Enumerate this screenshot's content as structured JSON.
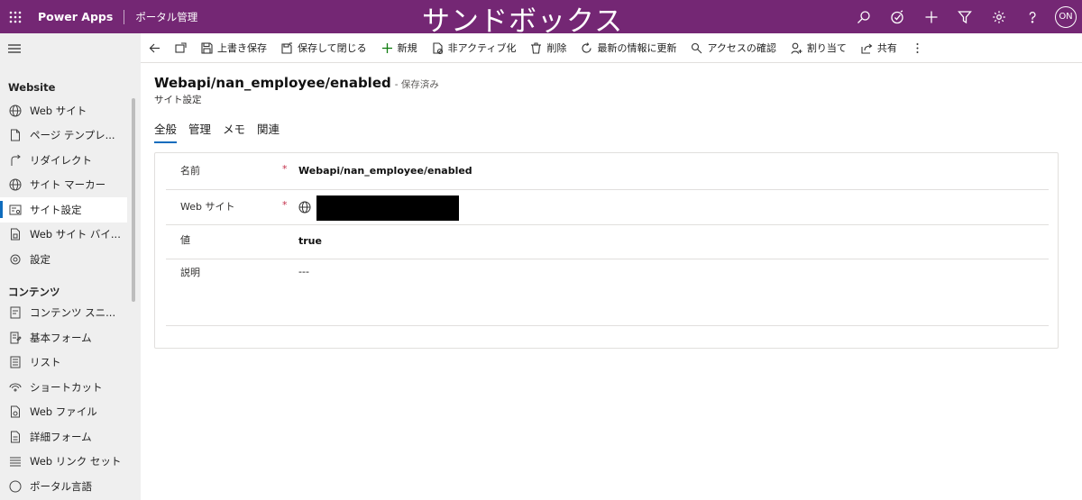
{
  "app": {
    "name": "Power Apps",
    "area": "ポータル管理",
    "banner": "サンドボックス",
    "user_initials": "ON"
  },
  "sidebar": {
    "groups": [
      {
        "label": "Website",
        "items": [
          {
            "label": "Web サイト",
            "icon": "globe-icon"
          },
          {
            "label": "ページ テンプレ...",
            "icon": "page-icon"
          },
          {
            "label": "リダイレクト",
            "icon": "redirect-icon"
          },
          {
            "label": "サイト マーカー",
            "icon": "globe-icon"
          },
          {
            "label": "サイト設定",
            "icon": "settings-list-icon",
            "active": true
          },
          {
            "label": "Web サイト バイ...",
            "icon": "binding-icon"
          },
          {
            "label": "設定",
            "icon": "gear-icon"
          }
        ]
      },
      {
        "label": "コンテンツ",
        "items": [
          {
            "label": "コンテンツ スニ...",
            "icon": "snippet-icon"
          },
          {
            "label": "基本フォーム",
            "icon": "form-icon"
          },
          {
            "label": "リスト",
            "icon": "list-icon"
          },
          {
            "label": "ショートカット",
            "icon": "shortcut-icon"
          },
          {
            "label": "Web ファイル",
            "icon": "file-icon"
          },
          {
            "label": "詳細フォーム",
            "icon": "advanced-form-icon"
          },
          {
            "label": "Web リンク セット",
            "icon": "link-set-icon"
          },
          {
            "label": "ポータル言語",
            "icon": "language-icon"
          }
        ]
      }
    ]
  },
  "commands": {
    "save": "上書き保存",
    "save_close": "保存して閉じる",
    "new": "新規",
    "deactivate": "非アクティブ化",
    "delete": "削除",
    "refresh": "最新の情報に更新",
    "check_access": "アクセスの確認",
    "assign": "割り当て",
    "share": "共有"
  },
  "record": {
    "title": "Webapi/nan_employee/enabled",
    "status": "- 保存済み",
    "entity": "サイト設定"
  },
  "tabs": [
    "全般",
    "管理",
    "メモ",
    "関連"
  ],
  "form": {
    "name_label": "名前",
    "name_value": "Webapi/nan_employee/enabled",
    "website_label": "Web サイト",
    "value_label": "値",
    "value_value": "true",
    "description_label": "説明",
    "description_value": "---",
    "required_mark": "*"
  }
}
